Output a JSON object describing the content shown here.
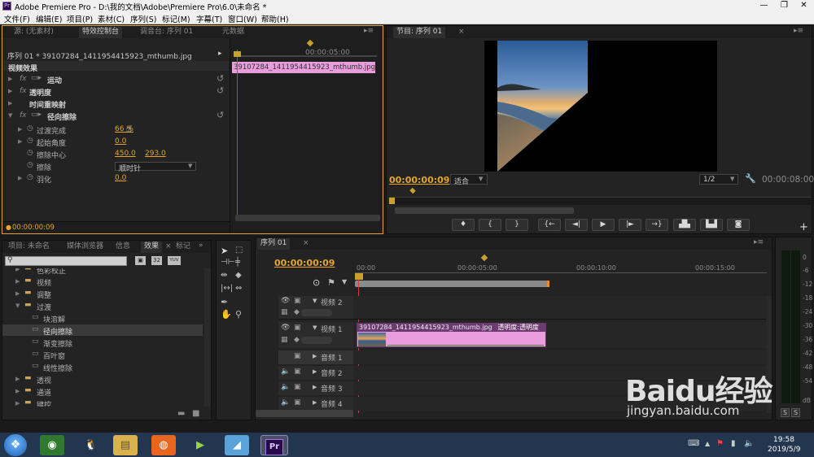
{
  "window": {
    "title": "Adobe Premiere Pro - D:\\我的文档\\Adobe\\Premiere Pro\\6.0\\未命名 *",
    "app_icon": "Pr"
  },
  "menu": [
    "文件(F)",
    "编辑(E)",
    "项目(P)",
    "素材(C)",
    "序列(S)",
    "标记(M)",
    "字幕(T)",
    "窗口(W)",
    "帮助(H)"
  ],
  "effect_controls": {
    "tabs": [
      "源: (无素材)",
      "特效控制台",
      "调音台: 序列 01",
      "元数据"
    ],
    "clip_header": "序列 01 * 39107284_1411954415923_mthumb.jpg",
    "ruler_time": "00:00:05:00",
    "clip_label": "39107284_1411954415923_mthumb.jpg",
    "section": "视频效果",
    "effects": [
      {
        "fx": "fx",
        "name": "运动"
      },
      {
        "fx": "fx",
        "name": "透明度"
      },
      {
        "fx": "",
        "name": "时间重映射"
      },
      {
        "fx": "fx",
        "name": "径向擦除"
      }
    ],
    "params": [
      {
        "name": "过渡完成",
        "value": "66 %"
      },
      {
        "name": "起始角度",
        "value": "0.0"
      },
      {
        "name": "擦除中心",
        "value": "450.0",
        "value2": "293.0"
      },
      {
        "name": "擦除",
        "value": "顺时针"
      },
      {
        "name": "羽化",
        "value": "0.0"
      }
    ],
    "timecode": "00:00:00:09"
  },
  "program": {
    "tab": "节目: 序列 01",
    "timecode": "00:00:00:09",
    "fit": "适合",
    "resolution": "1/2",
    "duration": "00:00:08:00",
    "transport_icons": [
      "marker-icon",
      "in-point-icon",
      "out-point-icon",
      "go-to-in-icon",
      "step-back-icon",
      "play-icon",
      "step-forward-icon",
      "go-to-out-icon",
      "lift-icon",
      "extract-icon",
      "export-frame-icon"
    ],
    "transport_glyphs": [
      "♦",
      "{",
      "}",
      "{←",
      "◄|",
      "▶",
      "|►",
      "→}",
      "▟▙",
      "▙▟",
      "◙"
    ]
  },
  "project": {
    "tabs": [
      "项目: 未命名",
      "媒体浏览器",
      "信息",
      "效果",
      "标记"
    ],
    "tree": [
      {
        "label": "色彩校正",
        "level": 1,
        "expanded": false
      },
      {
        "label": "视频",
        "level": 1,
        "expanded": false
      },
      {
        "label": "调整",
        "level": 1,
        "expanded": false
      },
      {
        "label": "过渡",
        "level": 1,
        "expanded": true
      },
      {
        "label": "块溶解",
        "level": 2
      },
      {
        "label": "径向擦除",
        "level": 2,
        "selected": true
      },
      {
        "label": "渐变擦除",
        "level": 2
      },
      {
        "label": "百叶窗",
        "level": 2
      },
      {
        "label": "线性擦除",
        "level": 2
      },
      {
        "label": "透视",
        "level": 1,
        "expanded": false
      },
      {
        "label": "通道",
        "level": 1,
        "expanded": false
      },
      {
        "label": "键控",
        "level": 1,
        "expanded": false
      }
    ],
    "badges": [
      "32",
      "YUV"
    ]
  },
  "timeline": {
    "tab": "序列 01",
    "timecode": "00:00:00:09",
    "ruler": [
      "00:00",
      "00:00:05:00",
      "00:00:10:00",
      "00:00:15:00"
    ],
    "video_tracks": [
      "视频 2",
      "视频 1"
    ],
    "audio_tracks": [
      "音频 1",
      "音频 2",
      "音频 3",
      "音频 4"
    ],
    "clip_label": "39107284_1411954415923_mthumb.jpg",
    "clip_fx": "透明度:透明度"
  },
  "audio_meter": {
    "ticks": [
      "0",
      "-6",
      "-12",
      "-18",
      "-24",
      "-30",
      "-36",
      "-42",
      "-48",
      "-54",
      "dB"
    ],
    "solo": [
      "S",
      "S"
    ]
  },
  "taskbar": {
    "time": "19:58",
    "date": "2019/5/9",
    "apps": [
      "Pr"
    ]
  },
  "watermark": {
    "text": "Baidu经验",
    "url": "jingyan.baidu.com"
  },
  "colors": {
    "accent": "#e5a52c",
    "clip": "#e99ddd",
    "playhead": "#d23c3c"
  }
}
